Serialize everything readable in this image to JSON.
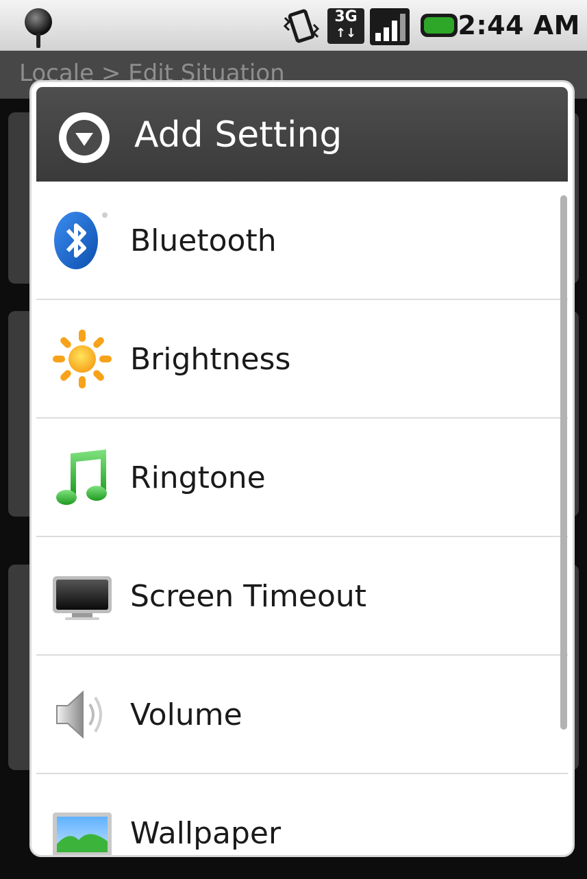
{
  "status_bar": {
    "time": "2:44 AM",
    "network_badge_top": "3G",
    "network_badge_bottom": "↑↓",
    "icons": [
      "location-pin-icon",
      "vibrate-icon",
      "network-3g-icon",
      "signal-strength-icon",
      "battery-icon"
    ]
  },
  "background": {
    "title": "Locale > Edit Situation"
  },
  "dialog": {
    "title": "Add Setting",
    "title_icon": "dropdown-circle-icon",
    "items": [
      {
        "label": "Bluetooth",
        "icon": "bluetooth-icon"
      },
      {
        "label": "Brightness",
        "icon": "brightness-icon"
      },
      {
        "label": "Ringtone",
        "icon": "ringtone-icon"
      },
      {
        "label": "Screen Timeout",
        "icon": "screen-timeout-icon"
      },
      {
        "label": "Volume",
        "icon": "volume-icon"
      },
      {
        "label": "Wallpaper",
        "icon": "wallpaper-icon"
      }
    ]
  },
  "colors": {
    "header_bg": "#444444",
    "item_text": "#1a1a1a",
    "bluetooth_blue": "#1a6fd6",
    "brightness_orange": "#f7a21b",
    "ringtone_green": "#3cb43c",
    "battery_green": "#2ea628"
  }
}
